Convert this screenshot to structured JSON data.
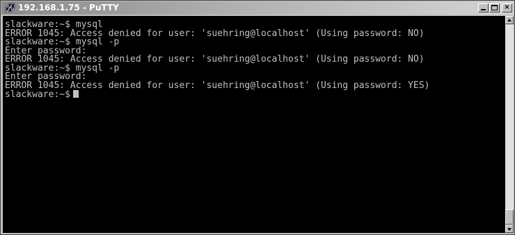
{
  "window": {
    "title": "192.168.1.75 - PuTTY",
    "app_icon": "putty-icon",
    "controls": {
      "minimize_icon": "minimize-icon",
      "maximize_icon": "maximize-icon",
      "close_icon": "close-icon",
      "close_glyph": "×"
    }
  },
  "terminal": {
    "background": "#000000",
    "foreground": "#c0c0c0",
    "lines": [
      "slackware:~$ mysql",
      "ERROR 1045: Access denied for user: 'suehring@localhost' (Using password: NO)",
      "slackware:~$ mysql -p",
      "Enter password:",
      "ERROR 1045: Access denied for user: 'suehring@localhost' (Using password: NO)",
      "slackware:~$ mysql -p",
      "Enter password:",
      "ERROR 1045: Access denied for user: 'suehring@localhost' (Using password: YES)",
      "slackware:~$"
    ]
  },
  "scrollbar": {
    "up_icon": "scroll-up-arrow-icon",
    "down_icon": "scroll-down-arrow-icon",
    "position": "bottom"
  }
}
